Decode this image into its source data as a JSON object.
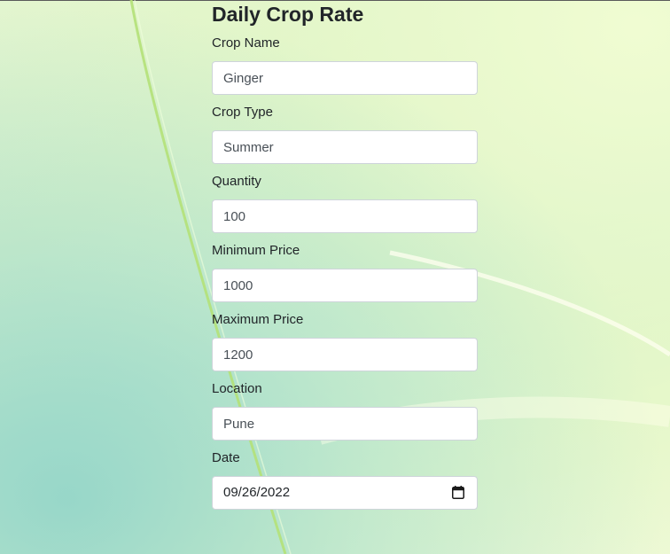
{
  "form": {
    "title": "Daily Crop Rate",
    "fields": {
      "crop_name": {
        "label": "Crop Name",
        "value": "Ginger"
      },
      "crop_type": {
        "label": "Crop Type",
        "value": "Summer"
      },
      "quantity": {
        "label": "Quantity",
        "value": "100"
      },
      "min_price": {
        "label": "Minimum Price",
        "value": "1000"
      },
      "max_price": {
        "label": "Maximum Price",
        "value": "1200"
      },
      "location": {
        "label": "Location",
        "value": "Pune"
      },
      "date": {
        "label": "Date",
        "value": "09/26/2022"
      }
    }
  },
  "icons": {
    "date_picker": "calendar-icon"
  },
  "colors": {
    "input_border": "#ced4da",
    "text": "#212529"
  }
}
